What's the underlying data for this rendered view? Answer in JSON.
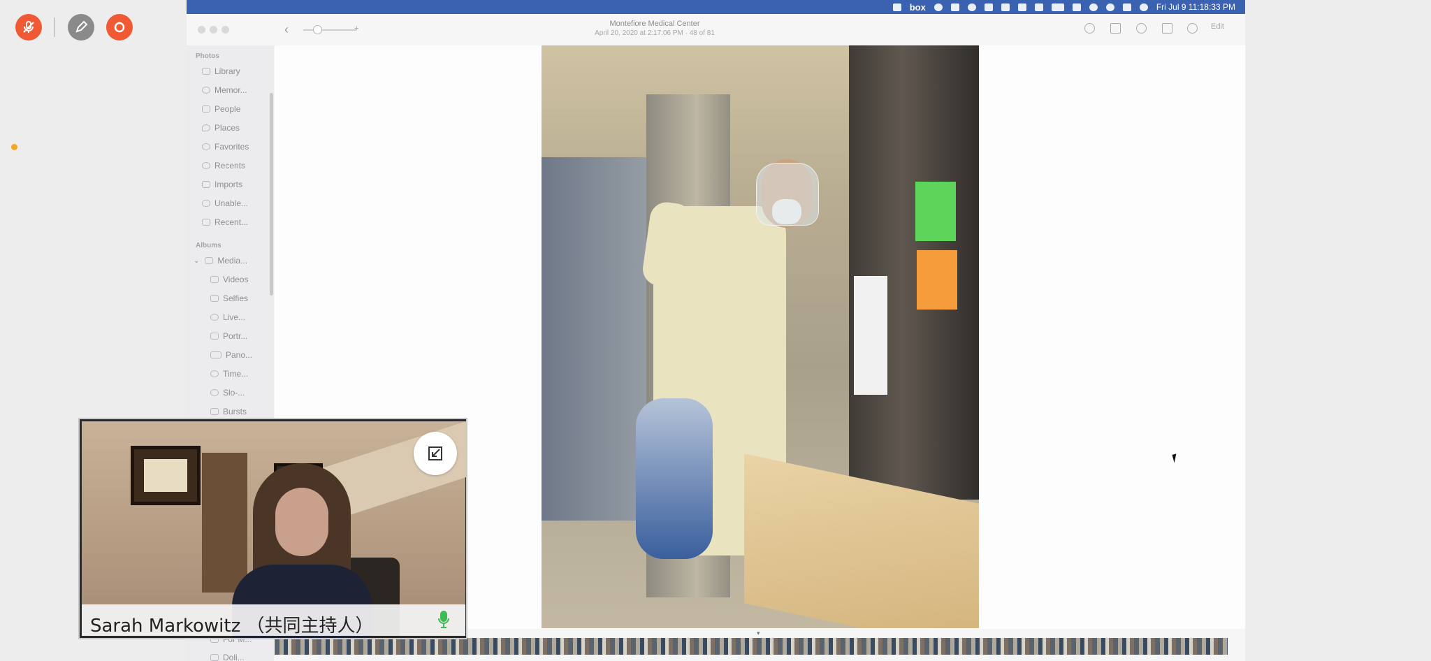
{
  "zoom_toolbar": {
    "unmute_icon": "microphone-off-icon",
    "remote_control_icon": "pencil-icon",
    "stop_share_icon": "stop-icon",
    "colors": {
      "red": "#ef5a34",
      "gray": "#8a8a8a"
    }
  },
  "menubar": {
    "box_label": "box",
    "datetime": "Fri Jul 9  11:18:33 PM",
    "color": "#3b62b0"
  },
  "photos_window": {
    "title": "Montefiore Medical Center",
    "subtitle": "April 20, 2020 at 2:17:06 PM  ·  48 of 81",
    "edit_label": "Edit",
    "sidebar": {
      "photos_header": "Photos",
      "photos_items": [
        "Library",
        "Memor...",
        "People",
        "Places",
        "Favorites",
        "Recents",
        "Imports",
        "Unable...",
        "Recent..."
      ],
      "albums_header": "Albums",
      "media_group": "Media...",
      "album_items": [
        "Videos",
        "Selfies",
        "Live...",
        "Portr...",
        "Pano...",
        "Time...",
        "Slo-...",
        "Bursts"
      ],
      "bottom_items": [
        "For M...",
        "Doli..."
      ]
    }
  },
  "video_tile": {
    "participant_name": "Sarah Markowitz （共同主持人）",
    "mic_color": "#3dbb55"
  }
}
